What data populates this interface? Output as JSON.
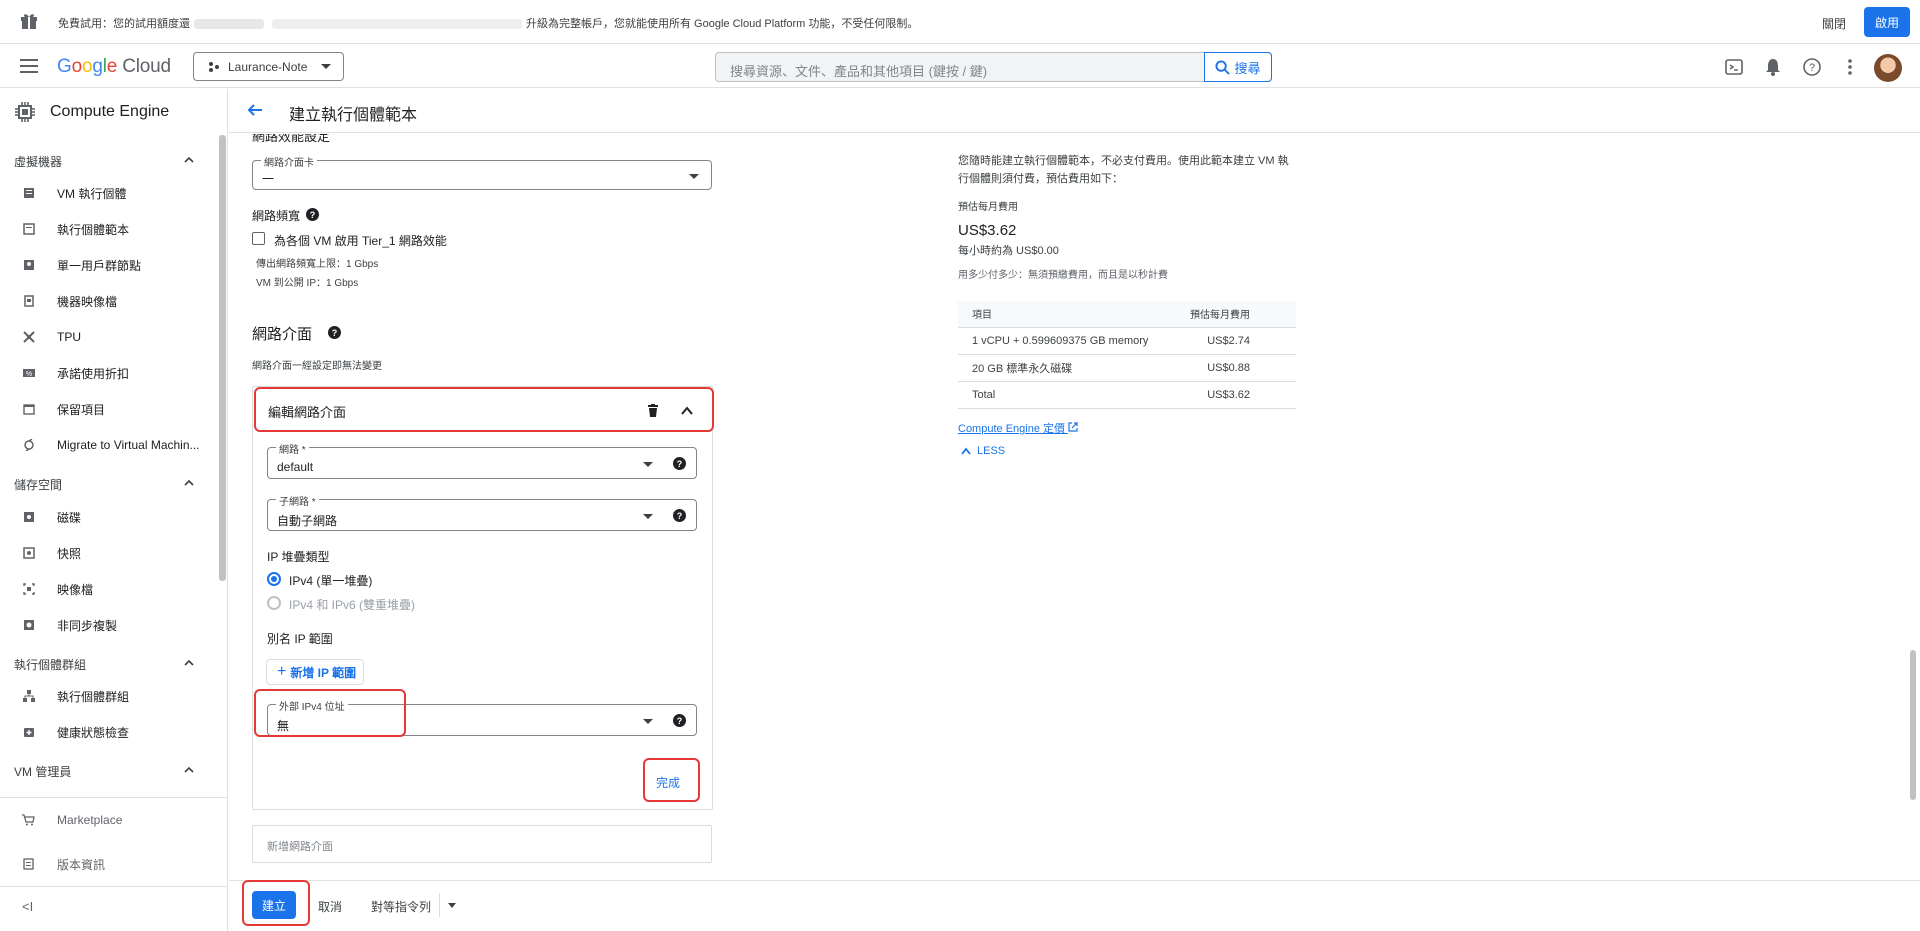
{
  "banner": {
    "text_a": "免費試用：您的試用額度還",
    "text_b": "升級為完整帳戶，您就能使用所有 Google Cloud Platform 功能，不受任何限制。",
    "dismiss_label": "關閉",
    "activate_label": "啟用"
  },
  "header": {
    "logo_google": [
      "G",
      "o",
      "o",
      "g",
      "l",
      "e"
    ],
    "logo_cloud": "Cloud",
    "project": "Laurance-Note",
    "search_placeholder": "搜尋資源、文件、產品和其他項目 (鍵按 / 鍵)",
    "search_button": "搜尋"
  },
  "sidebar": {
    "product": "Compute Engine",
    "sections": [
      {
        "label": "虛擬機器",
        "items": [
          "VM 執行個體",
          "執行個體範本",
          "單一用戶群節點",
          "機器映像檔",
          "TPU",
          "承諾使用折扣",
          "保留項目",
          "Migrate to Virtual Machin..."
        ]
      },
      {
        "label": "儲存空間",
        "items": [
          "磁碟",
          "快照",
          "映像檔",
          "非同步複製"
        ]
      },
      {
        "label": "執行個體群組",
        "items": [
          "執行個體群組",
          "健康狀態檢查"
        ]
      },
      {
        "label": "VM 管理員",
        "items": []
      }
    ],
    "marketplace": "Marketplace",
    "release_notes": "版本資訊",
    "collapse": "<I"
  },
  "page": {
    "title": "建立執行個體範本"
  },
  "form": {
    "perf_heading": "網路效能設定",
    "nic_card_label": "網路介面卡",
    "nic_card_value": "一",
    "bandwidth_label": "網路頻寬",
    "tier1_label": "為各個 VM 啟用 Tier_1 網路效能",
    "egress_note": "傳出網路頻寬上限：1 Gbps",
    "vm_ip_note": "VM 到公開 IP：1 Gbps",
    "nic_heading": "網路介面",
    "nic_note": "網路介面一經設定即無法變更",
    "edit_nic_title": "編輯網路介面",
    "network_label": "網路 *",
    "network_value": "default",
    "subnet_label": "子網路 *",
    "subnet_value": "自動子網路",
    "ip_stack_label": "IP 堆疊類型",
    "ipv4_label": "IPv4 (單一堆疊)",
    "dual_label": "IPv4 和 IPv6 (雙重堆疊)",
    "alias_label": "別名 IP 範圍",
    "add_ip_label": "新增 IP 範圍",
    "external_label": "外部 IPv4 位址",
    "external_value": "無",
    "done_label": "完成",
    "add_nic_label": "新增網路介面"
  },
  "pricing": {
    "intro": "您隨時能建立執行個體範本，不必支付費用。使用此範本建立 VM 執行個體則須付費，預估費用如下：",
    "monthly_label": "預估每月費用",
    "monthly_value": "US$3.62",
    "hourly": "每小時約為 US$0.00",
    "payg": "用多少付多少：無須預繳費用，而且是以秒計費",
    "col_item": "項目",
    "col_cost": "預估每月費用",
    "rows": [
      {
        "item": "1 vCPU + 0.599609375 GB memory",
        "cost": "US$2.74"
      },
      {
        "item": "20 GB 標準永久磁碟",
        "cost": "US$0.88"
      },
      {
        "item": "Total",
        "cost": "US$3.62"
      }
    ],
    "link": "Compute Engine 定價",
    "less": "LESS"
  },
  "footer": {
    "create": "建立",
    "cancel": "取消",
    "equivalent": "對等指令列"
  }
}
